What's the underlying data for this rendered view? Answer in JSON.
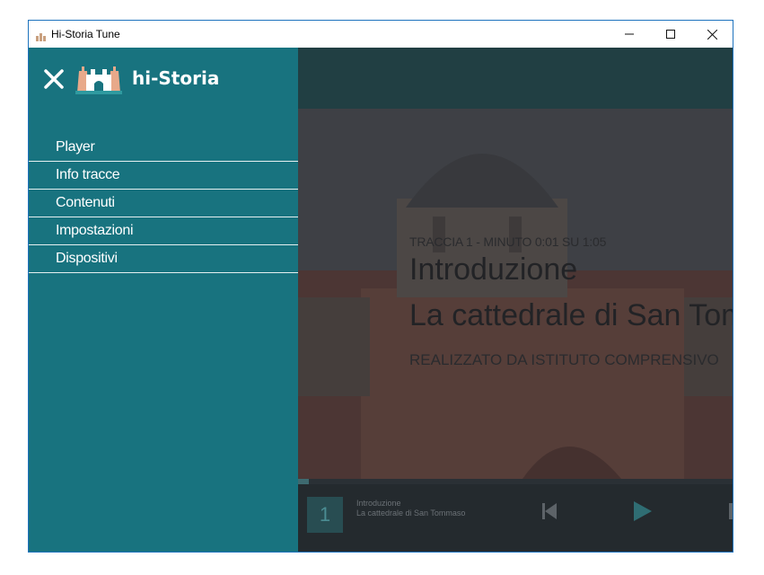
{
  "window": {
    "title": "Hi-Storia Tune",
    "controls": {
      "minimize": "minimize-icon",
      "maximize": "maximize-icon",
      "close": "close-icon"
    }
  },
  "sidebar": {
    "brand": "hi-Storia",
    "close_icon": "close-icon",
    "logo_icon": "castle-logo-icon",
    "items": [
      {
        "label": "Player"
      },
      {
        "label": "Info tracce"
      },
      {
        "label": "Contenuti"
      },
      {
        "label": "Impostazioni"
      },
      {
        "label": "Dispositivi"
      }
    ],
    "colors": {
      "background": "#18737f",
      "text": "#ffffff"
    }
  },
  "player": {
    "track_meta": "TRACCIA 1 - MINUTO 0:01 SU 1:05",
    "title": "Introduzione",
    "subtitle": "La cattedrale di San Tommaso",
    "author": "REALIZZATO DA ISTITUTO COMPRENSIVO",
    "progress": 0.025,
    "track_number": "1",
    "mini_title": "Introduzione",
    "mini_subtitle": "La cattedrale di San Tommaso",
    "controls": {
      "previous": "skip-previous-icon",
      "play": "play-icon"
    }
  }
}
